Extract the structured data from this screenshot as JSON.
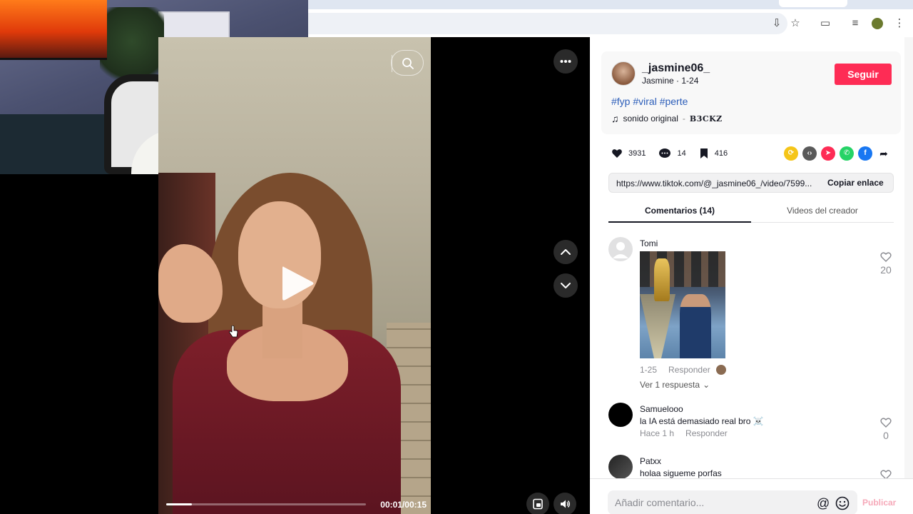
{
  "video": {
    "current_time": "00:01",
    "duration": "00:15",
    "time_label": "00:01/00:15",
    "progress": 0.13
  },
  "author": {
    "username": "_jasmine06_",
    "display_name": "Jasmine",
    "date": "1-24",
    "name_date": "Jasmine · 1-24",
    "follow_label": "Seguir",
    "hashtags": "#fyp #viral #perte",
    "music": "sonido original",
    "music_sep": "-",
    "music_artist": "B3CKZ"
  },
  "stats": {
    "likes": "3931",
    "comments": "14",
    "saves": "416"
  },
  "share": {
    "link": "https://www.tiktok.com/@_jasmine06_/video/7599...",
    "copy_label": "Copiar enlace"
  },
  "tabs": {
    "comments": "Comentarios (14)",
    "creator_videos": "Videos del creador"
  },
  "comments": [
    {
      "user": "Tomi",
      "text": "",
      "date": "1-25",
      "reply": "Responder",
      "likes": "20",
      "view_replies": "Ver 1 respuesta"
    },
    {
      "user": "Samuelooo",
      "text": "la IA está demasiado real bro ☠️",
      "date": "Hace 1 h",
      "reply": "Responder",
      "likes": "0"
    },
    {
      "user": "Patxx",
      "text": "holaa sigueme porfas",
      "likes": ""
    }
  ],
  "composer": {
    "placeholder": "Añadir comentario...",
    "publish_label": "Publicar"
  },
  "colors": {
    "accent": "#fe2c55",
    "hashtag": "#2b5db9"
  }
}
